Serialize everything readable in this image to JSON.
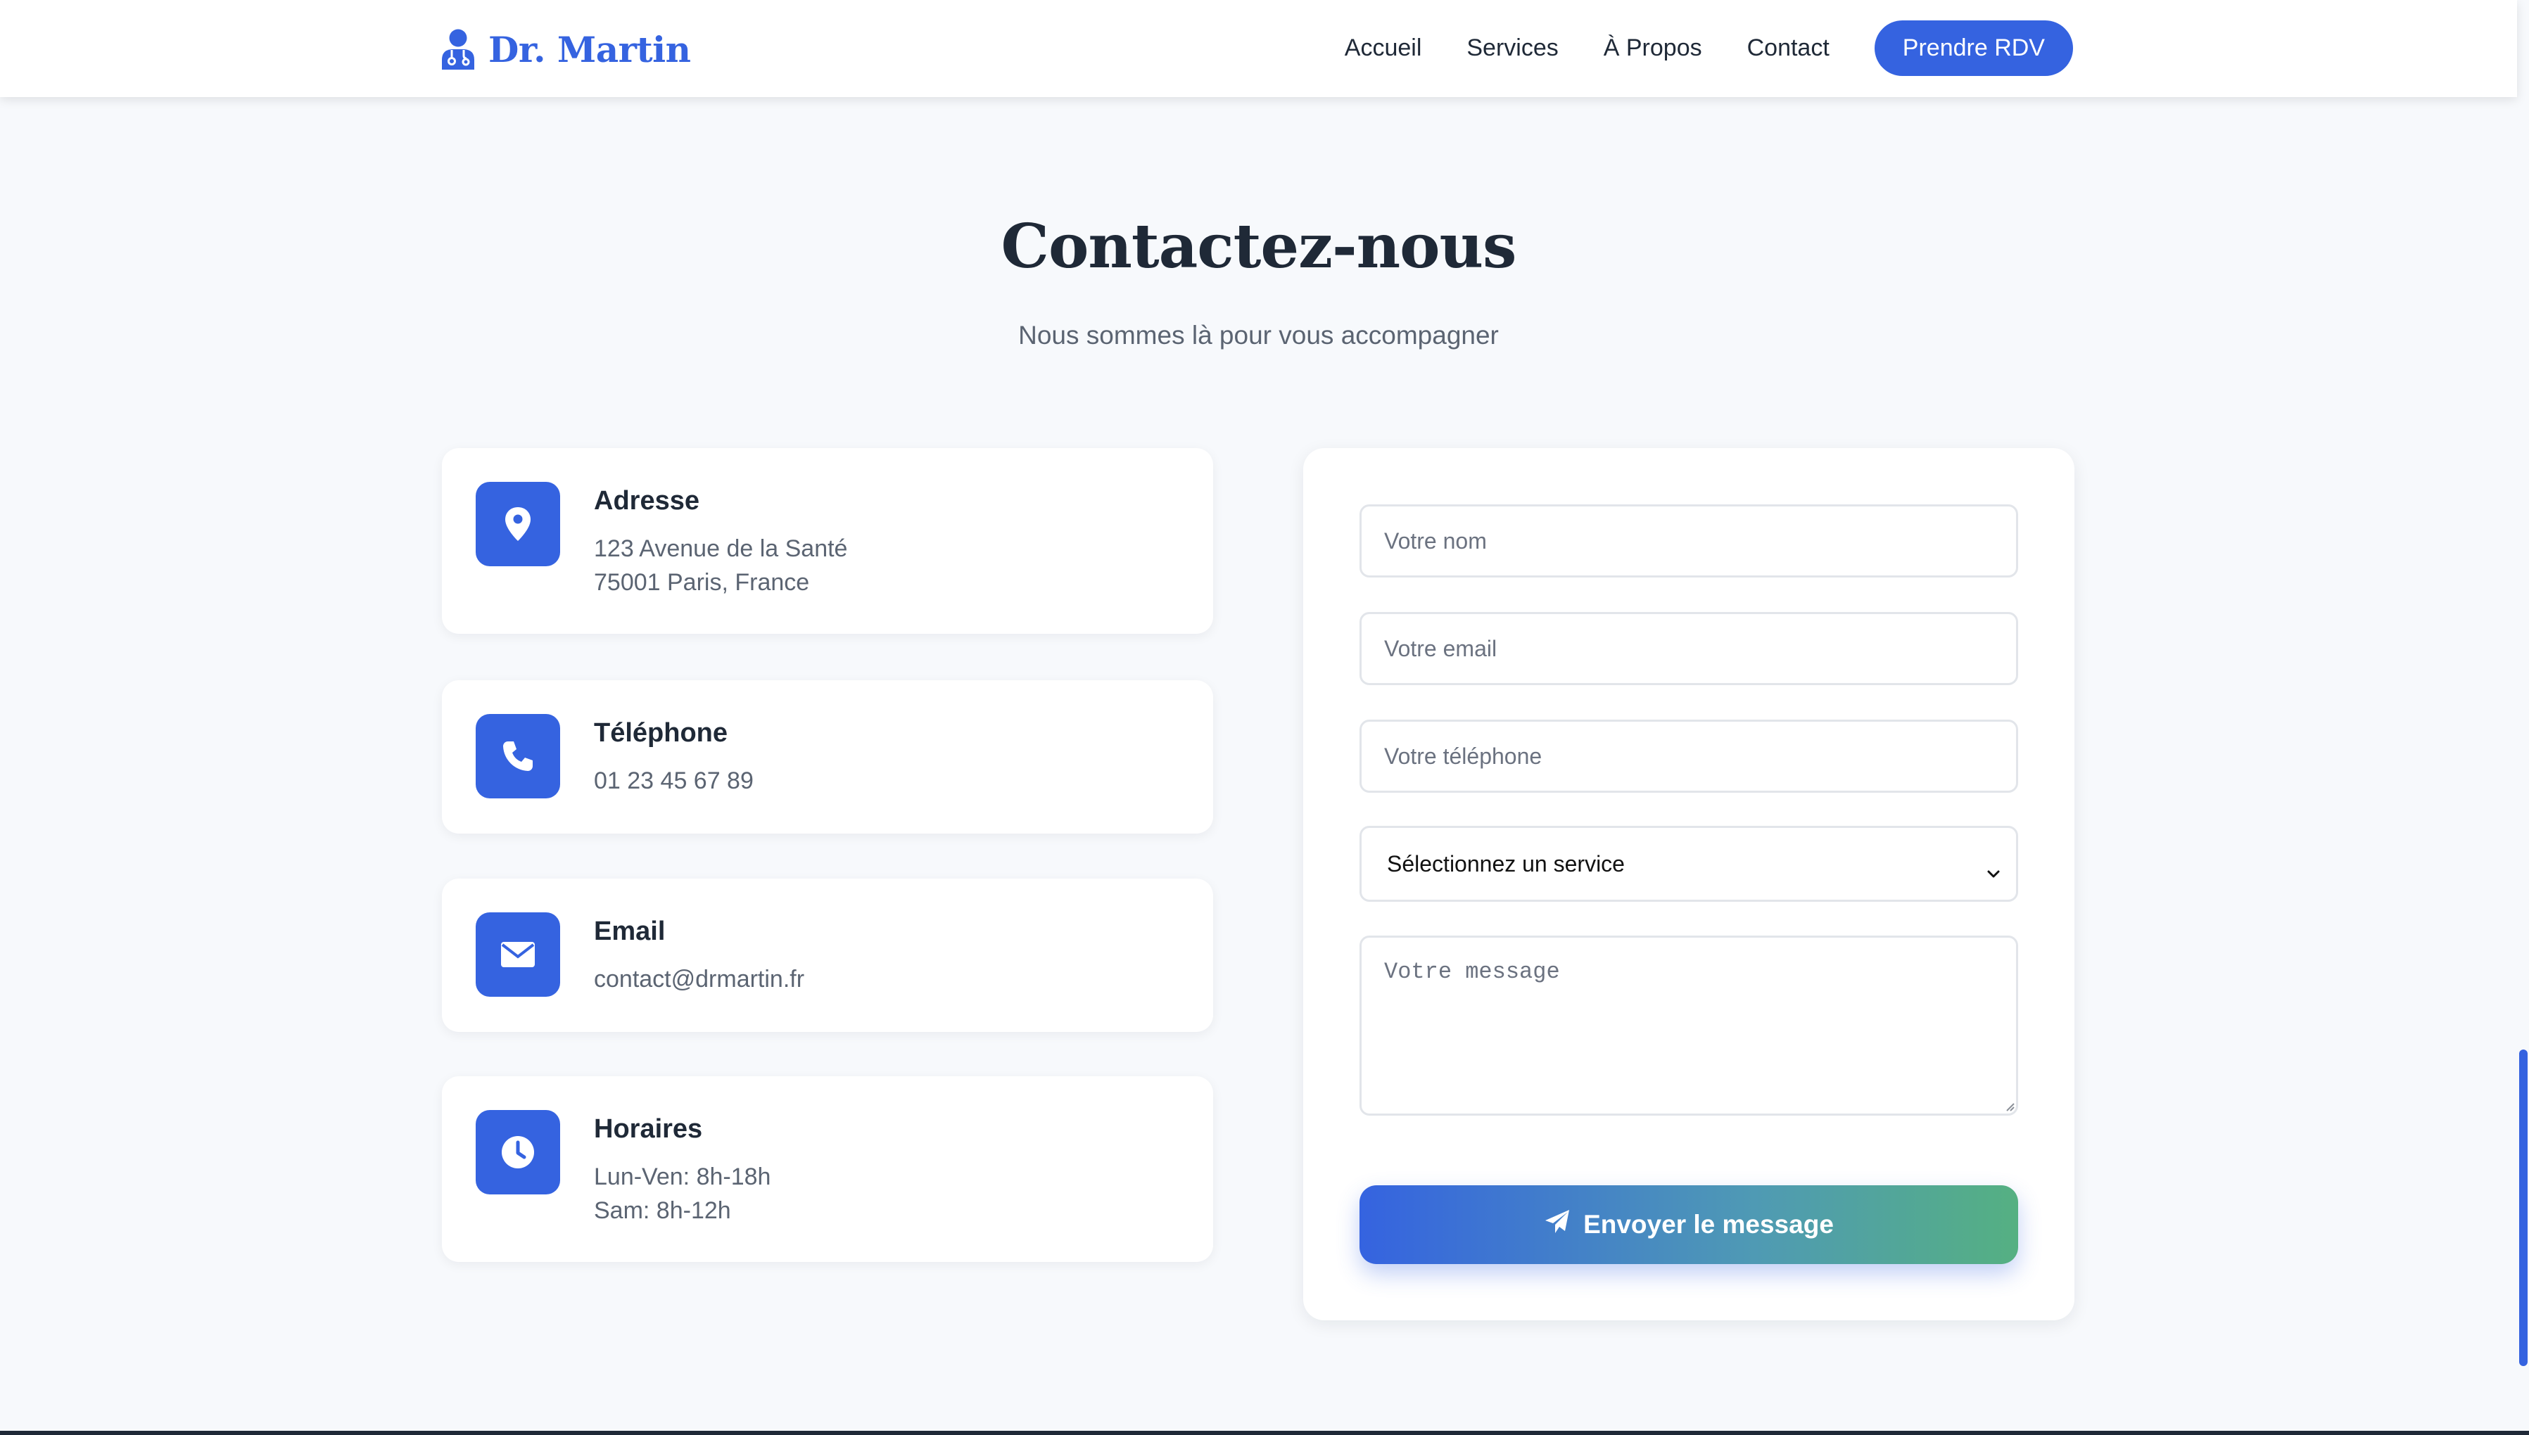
{
  "brand": {
    "name": "Dr. Martin",
    "icon": "doctor-user-icon",
    "color": "#3563e0"
  },
  "nav": {
    "links": [
      "Accueil",
      "Services",
      "À Propos",
      "Contact"
    ],
    "cta_label": "Prendre RDV"
  },
  "section": {
    "title": "Contactez-nous",
    "subtitle": "Nous sommes là pour vous accompagner"
  },
  "contact_info": [
    {
      "icon": "location-pin-icon",
      "title": "Adresse",
      "lines": [
        "123 Avenue de la Santé",
        "75001 Paris, France"
      ]
    },
    {
      "icon": "phone-icon",
      "title": "Téléphone",
      "lines": [
        "01 23 45 67 89"
      ]
    },
    {
      "icon": "envelope-icon",
      "title": "Email",
      "lines": [
        "contact@drmartin.fr"
      ]
    },
    {
      "icon": "clock-icon",
      "title": "Horaires",
      "lines": [
        "Lun-Ven: 8h-18h",
        "Sam: 8h-12h"
      ]
    }
  ],
  "form": {
    "name_placeholder": "Votre nom",
    "email_placeholder": "Votre email",
    "phone_placeholder": "Votre téléphone",
    "service_selected": "Sélectionnez un service",
    "message_placeholder": "Votre message",
    "submit_label": "Envoyer le message",
    "submit_icon": "paper-plane-icon"
  },
  "colors": {
    "accent": "#3563e0",
    "gradient_end": "#55b082",
    "background": "#f7f9fc",
    "heading": "#1f2937",
    "muted": "#5b6472"
  }
}
